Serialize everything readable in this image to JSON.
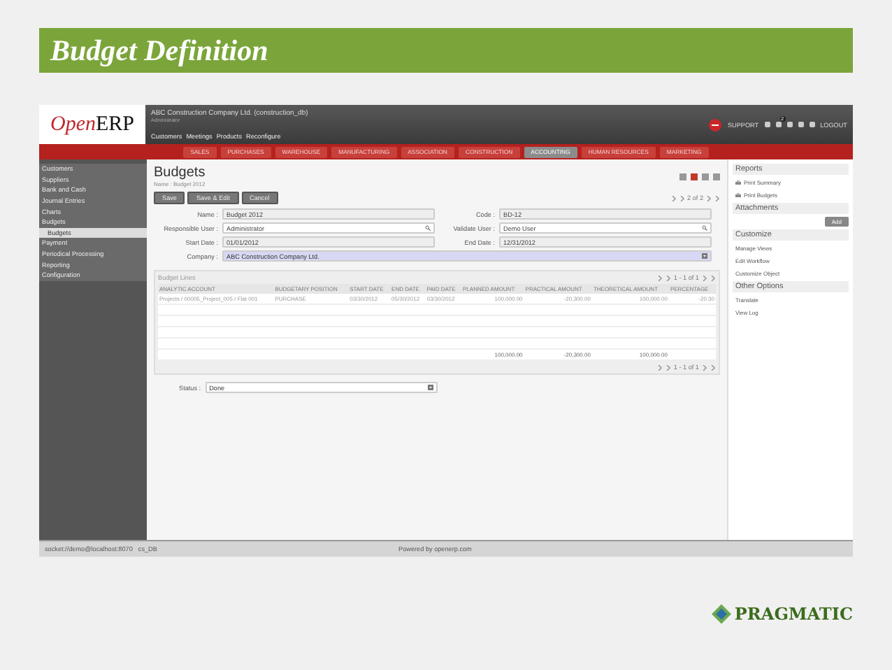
{
  "slide_title": "Budget Definition",
  "app": {
    "logo": {
      "part_1": "Open",
      "part_2": "ERP"
    },
    "company": "ABC Construction Company Ltd. (construction_db)",
    "user": "Administrator",
    "quick_links": [
      "Customers",
      "Meetings",
      "Products",
      "Reconfigure"
    ],
    "support": "SUPPORT",
    "notification_count": "2",
    "logout": "LOGOUT",
    "main_menu": [
      {
        "label": "SALES",
        "selected": false
      },
      {
        "label": "PURCHASES",
        "selected": false
      },
      {
        "label": "WAREHOUSE",
        "selected": false
      },
      {
        "label": "MANUFACTURING",
        "selected": false
      },
      {
        "label": "ASSOCIATION",
        "selected": false
      },
      {
        "label": "CONSTRUCTION",
        "selected": false
      },
      {
        "label": "ACCOUNTING",
        "selected": true
      },
      {
        "label": "HUMAN RESOURCES",
        "selected": false
      },
      {
        "label": "MARKETING",
        "selected": false
      }
    ],
    "sidebar": [
      {
        "label": "Customers",
        "selected": false
      },
      {
        "label": "Suppliers",
        "selected": false
      },
      {
        "label": "Bank and Cash",
        "selected": false
      },
      {
        "label": "Journal Entries",
        "selected": false
      },
      {
        "label": "Charts",
        "selected": false
      },
      {
        "label": "Budgets",
        "selected": false,
        "children": [
          {
            "label": "Budgets",
            "selected": true
          }
        ]
      },
      {
        "label": "Payment",
        "selected": false
      },
      {
        "label": "Periodical Processing",
        "selected": false
      },
      {
        "label": "Reporting",
        "selected": false
      },
      {
        "label": "Configuration",
        "selected": false
      }
    ],
    "form": {
      "title": "Budgets",
      "breadcrumb": "Name : Budget 2012",
      "buttons": [
        "Save",
        "Save & Edit",
        "Cancel"
      ],
      "pager": "2 of 2",
      "fields": [
        {
          "label": "Name :",
          "value": "Budget 2012",
          "kind": "text"
        },
        {
          "label": "Code :",
          "value": "BD-12",
          "kind": "text"
        },
        {
          "label": "Responsible User :",
          "value": "Administrator",
          "kind": "lookup"
        },
        {
          "label": "Validate User :",
          "value": "Demo User",
          "kind": "lookup"
        },
        {
          "label": "Start Date :",
          "value": "01/01/2012",
          "kind": "text"
        },
        {
          "label": "End Date :",
          "value": "12/31/2012",
          "kind": "text"
        },
        {
          "label": "Company :",
          "value": "ABC Construction Company Ltd.",
          "kind": "select"
        }
      ],
      "lines": {
        "title": "Budget Lines",
        "pager": "1 - 1 of 1",
        "columns": [
          "ANALYTIC ACCOUNT",
          "BUDGETARY POSITION",
          "START DATE",
          "END DATE",
          "PAID DATE",
          "PLANNED AMOUNT",
          "PRACTICAL AMOUNT",
          "THEORETICAL AMOUNT",
          "PERCENTAGE"
        ],
        "rows": [
          [
            "Projects / 00005_Project_005 / Flat 001",
            "PURCHASE",
            "03/30/2012",
            "05/30/2012",
            "03/30/2012",
            "100,000.00",
            "-20,300.00",
            "100,000.00",
            "-20.30"
          ]
        ],
        "totals": [
          "100,000.00",
          "-20,300.00",
          "100,000.00"
        ],
        "bottom_pager": "1 - 1 of 1"
      },
      "status": {
        "label": "Status :",
        "value": "Done"
      }
    },
    "right_panel": [
      {
        "title": "Reports",
        "items": [
          {
            "label": "Print Summary",
            "kind": "report"
          },
          {
            "label": "Print Budgets",
            "kind": "report"
          }
        ]
      },
      {
        "title": "Attachments",
        "items": [
          {
            "label": "Add",
            "kind": "button"
          }
        ]
      },
      {
        "title": "Customize",
        "items": [
          {
            "label": "Manage Views",
            "kind": "link"
          },
          {
            "label": "Edit Workflow",
            "kind": "link"
          },
          {
            "label": "Customize Object",
            "kind": "link"
          }
        ]
      },
      {
        "title": "Other Options",
        "items": [
          {
            "label": "Translate",
            "kind": "link"
          },
          {
            "label": "View Log",
            "kind": "link"
          }
        ]
      }
    ],
    "status_bar": {
      "connection": "socket://demo@localhost:8070",
      "database": "cs_DB",
      "powered_by": "Powered by openerp.com"
    }
  },
  "brand": "PRAGMATIC"
}
